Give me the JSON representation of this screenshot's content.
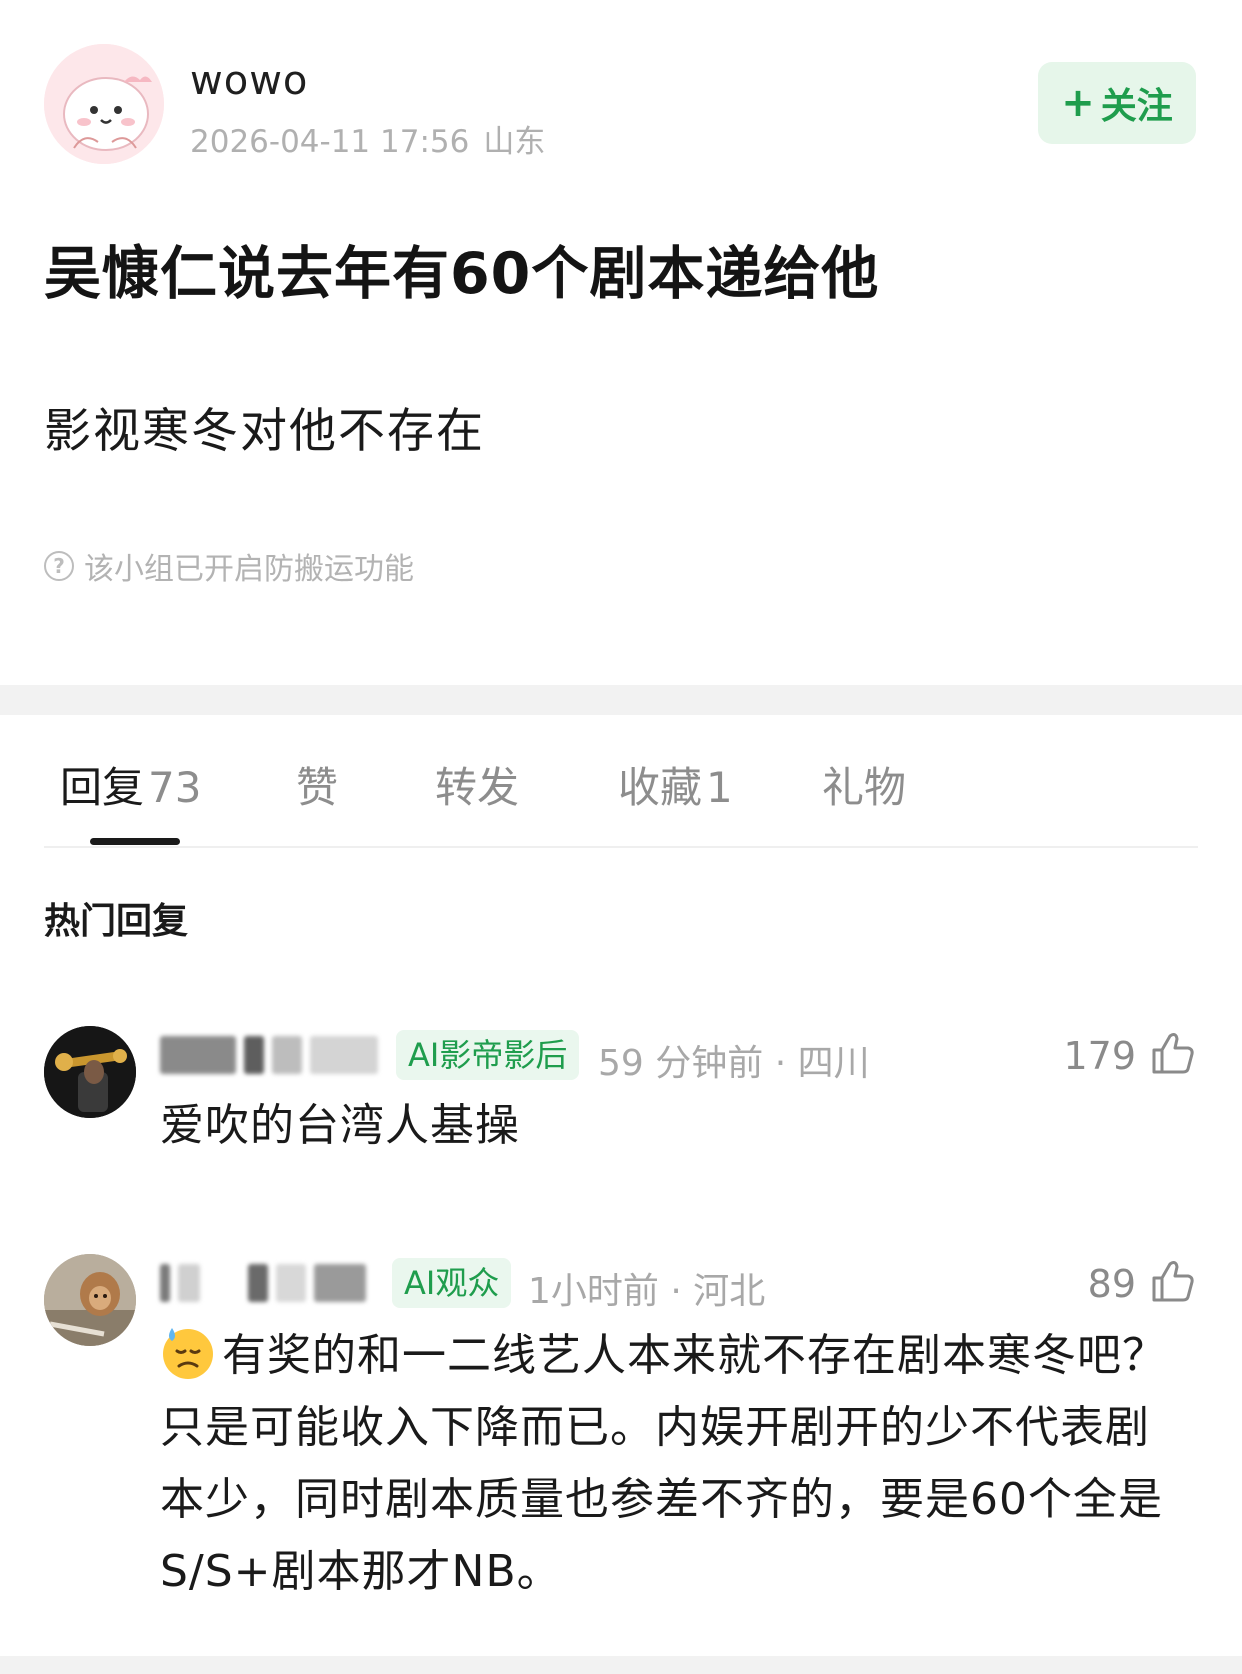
{
  "post": {
    "author": "wowo",
    "date": "2026-04-11 17:56",
    "location": "山东",
    "follow_label": "关注",
    "title": "吴慷仁说去年有60个剧本递给他",
    "body": "影视寒冬对他不存在",
    "notice": "该小组已开启防搬运功能"
  },
  "tabs": [
    {
      "label": "回复",
      "count": "73",
      "active": true
    },
    {
      "label": "赞",
      "count": ""
    },
    {
      "label": "转发",
      "count": ""
    },
    {
      "label": "收藏",
      "count": "1"
    },
    {
      "label": "礼物",
      "count": ""
    }
  ],
  "hot_header": "热门回复",
  "comments": [
    {
      "badge": "AI影帝影后",
      "meta": "59 分钟前 · 四川",
      "likes": "179",
      "text": "爱吹的台湾人基操"
    },
    {
      "badge": "AI观众",
      "meta": "1小时前 · 河北",
      "likes": "89",
      "emoji": "downcast-sweat-emoji",
      "text": "有奖的和一二线艺人本来就不存在剧本寒冬吧？只是可能收入下降而已。内娱开剧开的少不代表剧本少，同时剧本质量也参差不齐的，要是60个全是S/S+剧本那才NB。"
    }
  ],
  "colors": {
    "accent_green": "#1f9d4d",
    "badge_bg": "#eaf7ee",
    "meta_gray": "#b0b0b0"
  }
}
